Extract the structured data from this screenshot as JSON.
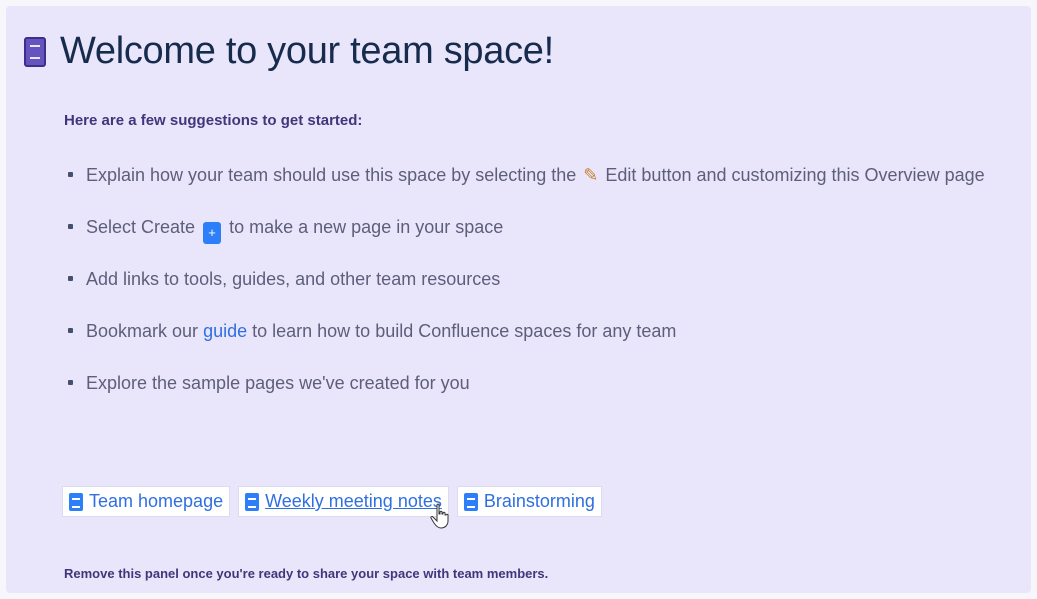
{
  "panel": {
    "title": "Welcome to your team space!",
    "subtitle": "Here are a few suggestions to get started:",
    "suggestions": [
      {
        "before": "Explain how your team should use this space by selecting the",
        "icon": "pencil-icon",
        "after": "Edit button and customizing this Overview page"
      },
      {
        "before": "Select Create",
        "icon": "create-icon",
        "after": "to make a new page in your space"
      },
      {
        "text": "Add links to tools, guides, and other team resources"
      },
      {
        "before": "Bookmark our",
        "link": "guide",
        "after": "to learn how to build Confluence spaces for any team"
      },
      {
        "text": "Explore the sample pages we've created for you"
      }
    ],
    "pages": [
      {
        "label": "Team homepage"
      },
      {
        "label": "Weekly meeting notes"
      },
      {
        "label": "Brainstorming"
      }
    ],
    "footnote": "Remove this panel once you're ready to share your space with team members."
  },
  "colors": {
    "panel_bg": "#e9e6fc",
    "link": "#2f6fe0",
    "title": "#172b4d",
    "accent": "#6554c0"
  }
}
